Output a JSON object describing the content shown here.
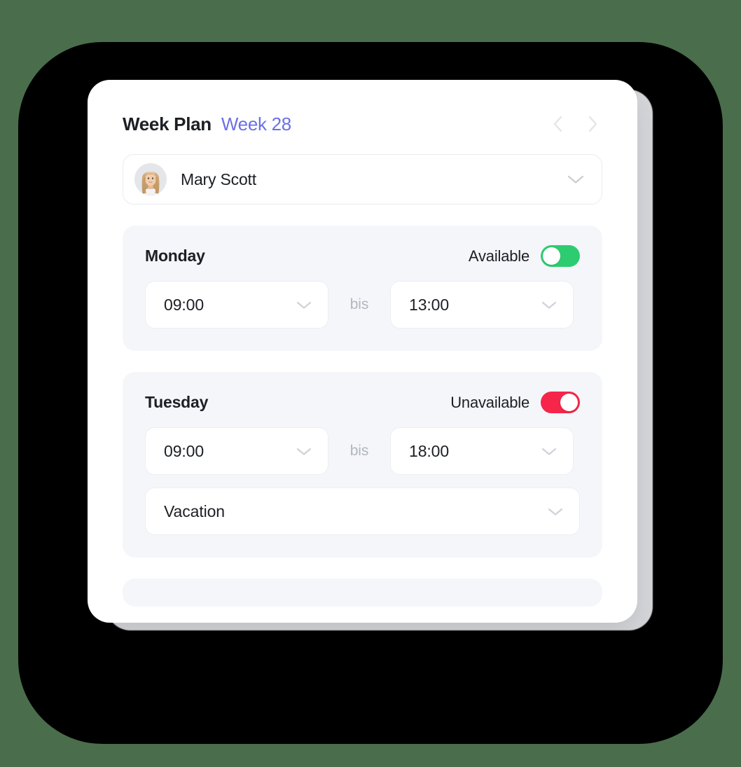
{
  "theme": {
    "background_color": "#4a6e4c",
    "plate_color": "#000000",
    "card_color": "#ffffff",
    "day_card_color": "#f4f6fa",
    "accent_blue": "#6b70e6",
    "available_green": "#2ecc71",
    "unavailable_red": "#f6254a",
    "text_primary": "#1c1f24",
    "text_muted": "#b2b6be"
  },
  "header": {
    "title": "Week Plan",
    "week_label": "Week 28",
    "prev_icon": "chevron-left-icon",
    "next_icon": "chevron-right-icon"
  },
  "person_select": {
    "name": "Mary Scott",
    "avatar_icon": "avatar-photo",
    "chevron_icon": "chevron-down-icon"
  },
  "labels": {
    "between": "bis",
    "chevron_icon": "chevron-down-icon"
  },
  "days": [
    {
      "name": "Monday",
      "status_label": "Available",
      "status_state": "available",
      "toggle_color": "#2ecc71",
      "toggle_knob": "left",
      "start_time": "09:00",
      "end_time": "13:00",
      "reason": null
    },
    {
      "name": "Tuesday",
      "status_label": "Unavailable",
      "status_state": "unavailable",
      "toggle_color": "#f6254a",
      "toggle_knob": "right",
      "start_time": "09:00",
      "end_time": "18:00",
      "reason": "Vacation"
    }
  ]
}
